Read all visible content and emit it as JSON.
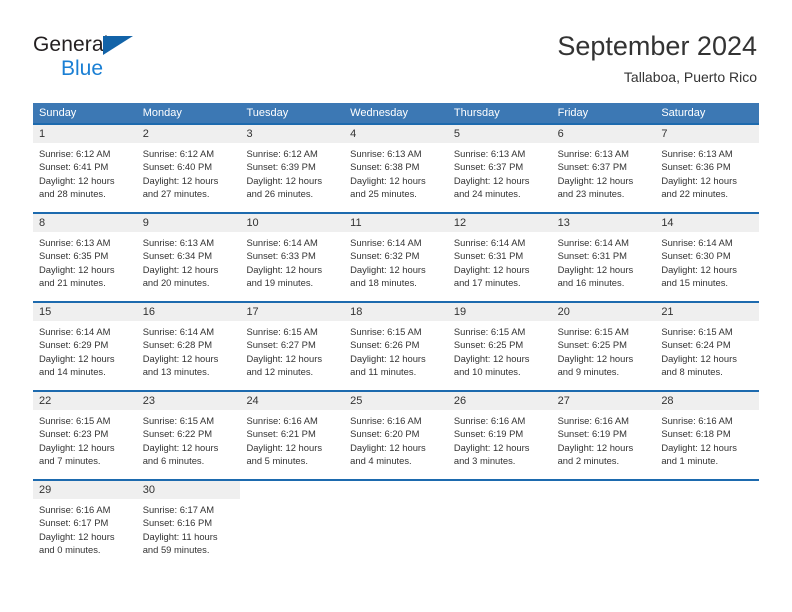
{
  "brand": {
    "name_top": "General",
    "name_bottom": "Blue",
    "triangle_color": "#1263a8",
    "blue_text_color": "#1a7fd4"
  },
  "header": {
    "title": "September 2024",
    "subtitle": "Tallaboa, Puerto Rico"
  },
  "theme": {
    "header_blue": "#3c78b4",
    "row_divider_blue": "#1d6aae",
    "daynum_band_gray": "#efefef",
    "text_color": "#333333"
  },
  "weekdays": [
    "Sunday",
    "Monday",
    "Tuesday",
    "Wednesday",
    "Thursday",
    "Friday",
    "Saturday"
  ],
  "weeks": [
    [
      {
        "day": "1",
        "sunrise": "Sunrise: 6:12 AM",
        "sunset": "Sunset: 6:41 PM",
        "daylight1": "Daylight: 12 hours",
        "daylight2": "and 28 minutes."
      },
      {
        "day": "2",
        "sunrise": "Sunrise: 6:12 AM",
        "sunset": "Sunset: 6:40 PM",
        "daylight1": "Daylight: 12 hours",
        "daylight2": "and 27 minutes."
      },
      {
        "day": "3",
        "sunrise": "Sunrise: 6:12 AM",
        "sunset": "Sunset: 6:39 PM",
        "daylight1": "Daylight: 12 hours",
        "daylight2": "and 26 minutes."
      },
      {
        "day": "4",
        "sunrise": "Sunrise: 6:13 AM",
        "sunset": "Sunset: 6:38 PM",
        "daylight1": "Daylight: 12 hours",
        "daylight2": "and 25 minutes."
      },
      {
        "day": "5",
        "sunrise": "Sunrise: 6:13 AM",
        "sunset": "Sunset: 6:37 PM",
        "daylight1": "Daylight: 12 hours",
        "daylight2": "and 24 minutes."
      },
      {
        "day": "6",
        "sunrise": "Sunrise: 6:13 AM",
        "sunset": "Sunset: 6:37 PM",
        "daylight1": "Daylight: 12 hours",
        "daylight2": "and 23 minutes."
      },
      {
        "day": "7",
        "sunrise": "Sunrise: 6:13 AM",
        "sunset": "Sunset: 6:36 PM",
        "daylight1": "Daylight: 12 hours",
        "daylight2": "and 22 minutes."
      }
    ],
    [
      {
        "day": "8",
        "sunrise": "Sunrise: 6:13 AM",
        "sunset": "Sunset: 6:35 PM",
        "daylight1": "Daylight: 12 hours",
        "daylight2": "and 21 minutes."
      },
      {
        "day": "9",
        "sunrise": "Sunrise: 6:13 AM",
        "sunset": "Sunset: 6:34 PM",
        "daylight1": "Daylight: 12 hours",
        "daylight2": "and 20 minutes."
      },
      {
        "day": "10",
        "sunrise": "Sunrise: 6:14 AM",
        "sunset": "Sunset: 6:33 PM",
        "daylight1": "Daylight: 12 hours",
        "daylight2": "and 19 minutes."
      },
      {
        "day": "11",
        "sunrise": "Sunrise: 6:14 AM",
        "sunset": "Sunset: 6:32 PM",
        "daylight1": "Daylight: 12 hours",
        "daylight2": "and 18 minutes."
      },
      {
        "day": "12",
        "sunrise": "Sunrise: 6:14 AM",
        "sunset": "Sunset: 6:31 PM",
        "daylight1": "Daylight: 12 hours",
        "daylight2": "and 17 minutes."
      },
      {
        "day": "13",
        "sunrise": "Sunrise: 6:14 AM",
        "sunset": "Sunset: 6:31 PM",
        "daylight1": "Daylight: 12 hours",
        "daylight2": "and 16 minutes."
      },
      {
        "day": "14",
        "sunrise": "Sunrise: 6:14 AM",
        "sunset": "Sunset: 6:30 PM",
        "daylight1": "Daylight: 12 hours",
        "daylight2": "and 15 minutes."
      }
    ],
    [
      {
        "day": "15",
        "sunrise": "Sunrise: 6:14 AM",
        "sunset": "Sunset: 6:29 PM",
        "daylight1": "Daylight: 12 hours",
        "daylight2": "and 14 minutes."
      },
      {
        "day": "16",
        "sunrise": "Sunrise: 6:14 AM",
        "sunset": "Sunset: 6:28 PM",
        "daylight1": "Daylight: 12 hours",
        "daylight2": "and 13 minutes."
      },
      {
        "day": "17",
        "sunrise": "Sunrise: 6:15 AM",
        "sunset": "Sunset: 6:27 PM",
        "daylight1": "Daylight: 12 hours",
        "daylight2": "and 12 minutes."
      },
      {
        "day": "18",
        "sunrise": "Sunrise: 6:15 AM",
        "sunset": "Sunset: 6:26 PM",
        "daylight1": "Daylight: 12 hours",
        "daylight2": "and 11 minutes."
      },
      {
        "day": "19",
        "sunrise": "Sunrise: 6:15 AM",
        "sunset": "Sunset: 6:25 PM",
        "daylight1": "Daylight: 12 hours",
        "daylight2": "and 10 minutes."
      },
      {
        "day": "20",
        "sunrise": "Sunrise: 6:15 AM",
        "sunset": "Sunset: 6:25 PM",
        "daylight1": "Daylight: 12 hours",
        "daylight2": "and 9 minutes."
      },
      {
        "day": "21",
        "sunrise": "Sunrise: 6:15 AM",
        "sunset": "Sunset: 6:24 PM",
        "daylight1": "Daylight: 12 hours",
        "daylight2": "and 8 minutes."
      }
    ],
    [
      {
        "day": "22",
        "sunrise": "Sunrise: 6:15 AM",
        "sunset": "Sunset: 6:23 PM",
        "daylight1": "Daylight: 12 hours",
        "daylight2": "and 7 minutes."
      },
      {
        "day": "23",
        "sunrise": "Sunrise: 6:15 AM",
        "sunset": "Sunset: 6:22 PM",
        "daylight1": "Daylight: 12 hours",
        "daylight2": "and 6 minutes."
      },
      {
        "day": "24",
        "sunrise": "Sunrise: 6:16 AM",
        "sunset": "Sunset: 6:21 PM",
        "daylight1": "Daylight: 12 hours",
        "daylight2": "and 5 minutes."
      },
      {
        "day": "25",
        "sunrise": "Sunrise: 6:16 AM",
        "sunset": "Sunset: 6:20 PM",
        "daylight1": "Daylight: 12 hours",
        "daylight2": "and 4 minutes."
      },
      {
        "day": "26",
        "sunrise": "Sunrise: 6:16 AM",
        "sunset": "Sunset: 6:19 PM",
        "daylight1": "Daylight: 12 hours",
        "daylight2": "and 3 minutes."
      },
      {
        "day": "27",
        "sunrise": "Sunrise: 6:16 AM",
        "sunset": "Sunset: 6:19 PM",
        "daylight1": "Daylight: 12 hours",
        "daylight2": "and 2 minutes."
      },
      {
        "day": "28",
        "sunrise": "Sunrise: 6:16 AM",
        "sunset": "Sunset: 6:18 PM",
        "daylight1": "Daylight: 12 hours",
        "daylight2": "and 1 minute."
      }
    ],
    [
      {
        "day": "29",
        "sunrise": "Sunrise: 6:16 AM",
        "sunset": "Sunset: 6:17 PM",
        "daylight1": "Daylight: 12 hours",
        "daylight2": "and 0 minutes."
      },
      {
        "day": "30",
        "sunrise": "Sunrise: 6:17 AM",
        "sunset": "Sunset: 6:16 PM",
        "daylight1": "Daylight: 11 hours",
        "daylight2": "and 59 minutes."
      },
      {
        "day": "",
        "sunrise": "",
        "sunset": "",
        "daylight1": "",
        "daylight2": ""
      },
      {
        "day": "",
        "sunrise": "",
        "sunset": "",
        "daylight1": "",
        "daylight2": ""
      },
      {
        "day": "",
        "sunrise": "",
        "sunset": "",
        "daylight1": "",
        "daylight2": ""
      },
      {
        "day": "",
        "sunrise": "",
        "sunset": "",
        "daylight1": "",
        "daylight2": ""
      },
      {
        "day": "",
        "sunrise": "",
        "sunset": "",
        "daylight1": "",
        "daylight2": ""
      }
    ]
  ]
}
